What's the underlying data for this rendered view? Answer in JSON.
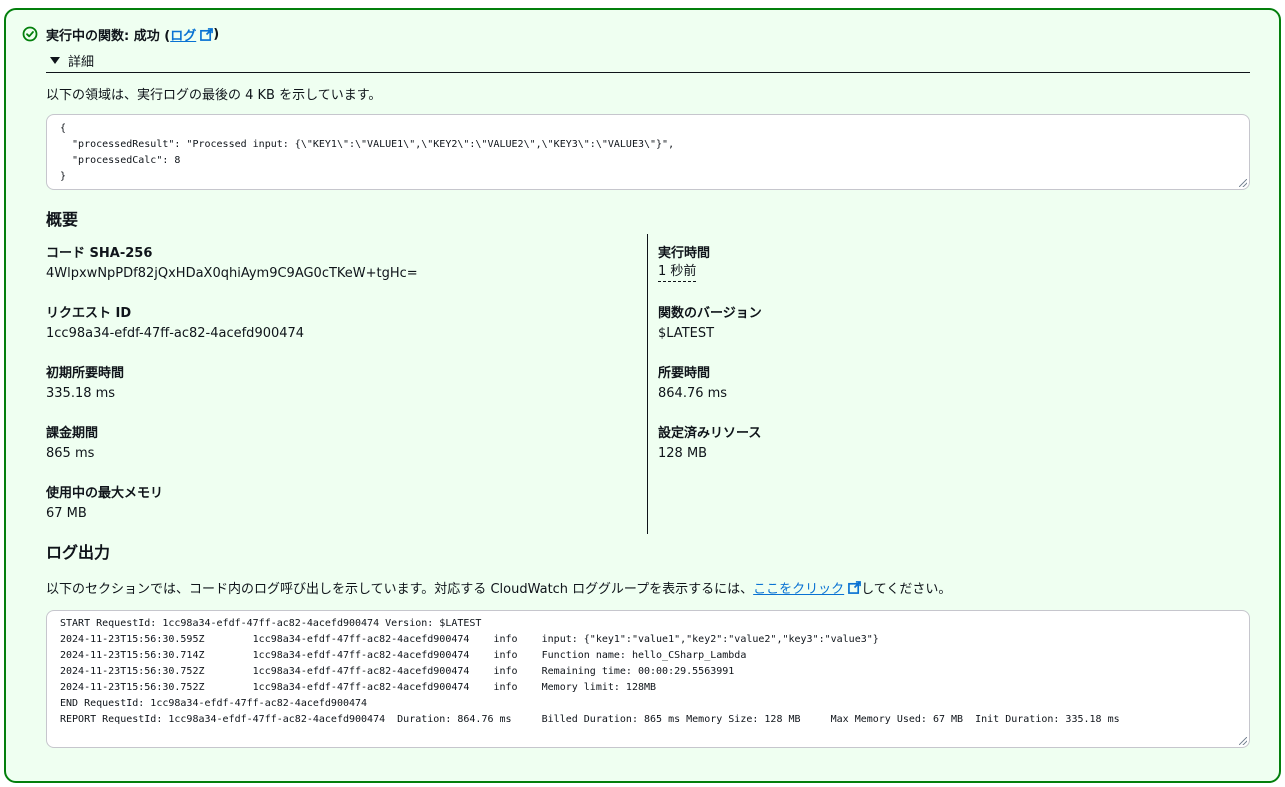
{
  "header": {
    "status_text": "実行中の関数: 成功 (",
    "log_link": "ログ",
    "close_paren": ")"
  },
  "details": {
    "toggle_label": "詳細",
    "description": "以下の領域は、実行ログの最後の 4 KB を示しています。",
    "result_lines": [
      "{",
      "  \"processedResult\": \"Processed input: {\\\"KEY1\\\":\\\"VALUE1\\\",\\\"KEY2\\\":\\\"VALUE2\\\",\\\"KEY3\\\":\\\"VALUE3\\\"}\",",
      "  \"processedCalc\": 8",
      "}"
    ]
  },
  "summary": {
    "title": "概要",
    "left": [
      {
        "key": "コード SHA-256",
        "value": "4WlpxwNpPDf82jQxHDaX0qhiAym9C9AG0cTKeW+tgHc="
      },
      {
        "key": "リクエスト ID",
        "value": "1cc98a34-efdf-47ff-ac82-4acefd900474"
      },
      {
        "key": "初期所要時間",
        "value": "335.18 ms"
      },
      {
        "key": "課金期間",
        "value": "865 ms"
      },
      {
        "key": "使用中の最大メモリ",
        "value": "67 MB"
      }
    ],
    "right": [
      {
        "key": "実行時間",
        "value": "1 秒前"
      },
      {
        "key": "関数のバージョン",
        "value": "$LATEST"
      },
      {
        "key": "所要時間",
        "value": "864.76 ms"
      },
      {
        "key": "設定済みリソース",
        "value": "128 MB"
      }
    ]
  },
  "log_output": {
    "title": "ログ出力",
    "desc_before": "以下のセクションでは、コード内のログ呼び出しを示しています。対応する CloudWatch ロググループを表示するには、",
    "link_text": "ここをクリック",
    "desc_after": "してください。",
    "lines": [
      "START RequestId: 1cc98a34-efdf-47ff-ac82-4acefd900474 Version: $LATEST",
      "2024-11-23T15:56:30.595Z\t1cc98a34-efdf-47ff-ac82-4acefd900474\tinfo\tinput: {\"key1\":\"value1\",\"key2\":\"value2\",\"key3\":\"value3\"}",
      "2024-11-23T15:56:30.714Z\t1cc98a34-efdf-47ff-ac82-4acefd900474\tinfo\tFunction name: hello_CSharp_Lambda",
      "2024-11-23T15:56:30.752Z\t1cc98a34-efdf-47ff-ac82-4acefd900474\tinfo\tRemaining time: 00:00:29.5563991",
      "2024-11-23T15:56:30.752Z\t1cc98a34-efdf-47ff-ac82-4acefd900474\tinfo\tMemory limit: 128MB",
      "END RequestId: 1cc98a34-efdf-47ff-ac82-4acefd900474",
      "REPORT RequestId: 1cc98a34-efdf-47ff-ac82-4acefd900474\tDuration: 864.76 ms\tBilled Duration: 865 ms\tMemory Size: 128 MB\tMax Memory Used: 67 MB\tInit Duration: 335.18 ms"
    ]
  },
  "colors": {
    "success_border": "#037f0c",
    "success_bg": "#effff1",
    "link": "#0972d3"
  },
  "icons": {
    "status": "success-check-icon",
    "external": "external-link-icon",
    "caret": "caret-down-icon"
  }
}
